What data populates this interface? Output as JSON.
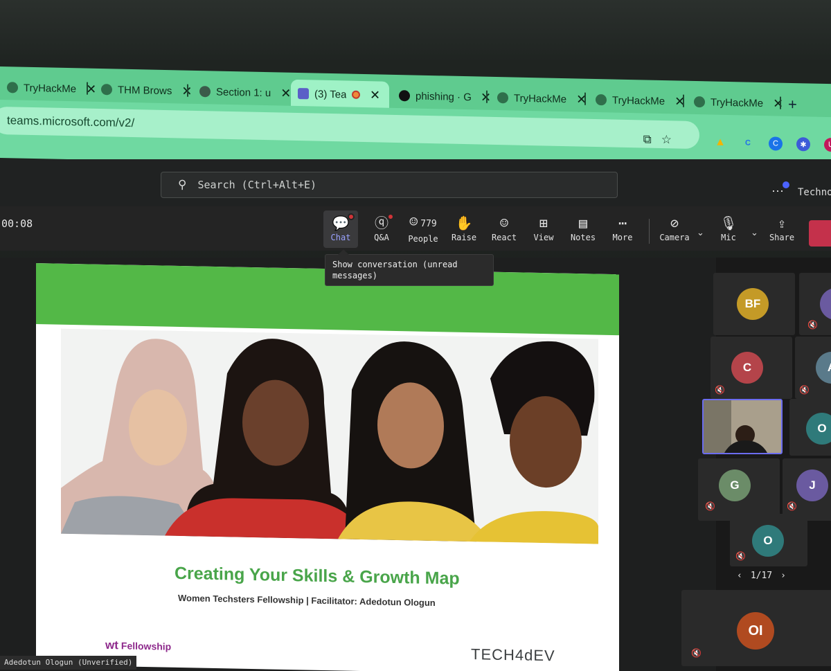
{
  "browser": {
    "tabs": [
      {
        "title": "TryHackMe",
        "icon": "thm-favicon"
      },
      {
        "title": "THM Brows",
        "icon": "thm-favicon"
      },
      {
        "title": "Section 1: u",
        "icon": "globe-icon"
      },
      {
        "title": "(3) Tea",
        "icon": "teams-icon"
      },
      {
        "title": "phishing · G",
        "icon": "github-icon"
      },
      {
        "title": "TryHackMe",
        "icon": "thm-favicon"
      },
      {
        "title": "TryHackMe",
        "icon": "thm-favicon"
      },
      {
        "title": "TryHackMe",
        "icon": "thm-favicon"
      }
    ],
    "url": "teams.microsoft.com/v2/"
  },
  "teams": {
    "search_placeholder": "Search (Ctrl+Alt+E)",
    "org_name": "Techno",
    "timer": "00:08",
    "toolbar": {
      "chat": "Chat",
      "qa": "Q&A",
      "people": "People",
      "people_count": "779",
      "raise": "Raise",
      "react": "React",
      "view": "View",
      "notes": "Notes",
      "more": "More",
      "camera": "Camera",
      "mic": "Mic",
      "share": "Share"
    },
    "tooltip": "Show conversation (unread messages)"
  },
  "slide": {
    "title": "Creating Your Skills & Growth Map",
    "subtitle": "Women Techsters Fellowship | Facilitator: Adedotun Ologun",
    "logo_mark": "wt",
    "logo_text": "Fellowship",
    "brand": "TECH4dEV"
  },
  "presenter_label": "Adedotun Ologun (Unverified)",
  "participants": [
    {
      "initials": "BF",
      "color": "#c49a27"
    },
    {
      "initials": "C",
      "color": "#b4444a"
    },
    {
      "initials": "A",
      "color": "#5a7a8a"
    },
    {
      "initials": "O",
      "color": "#2f7a7a"
    },
    {
      "initials": "G",
      "color": "#6b8c68"
    },
    {
      "initials": "J",
      "color": "#6a5aa0"
    },
    {
      "initials": "O",
      "color": "#2f7a7a"
    },
    {
      "initials": "OI",
      "color": "#b04a20"
    }
  ],
  "pager": "1/17"
}
